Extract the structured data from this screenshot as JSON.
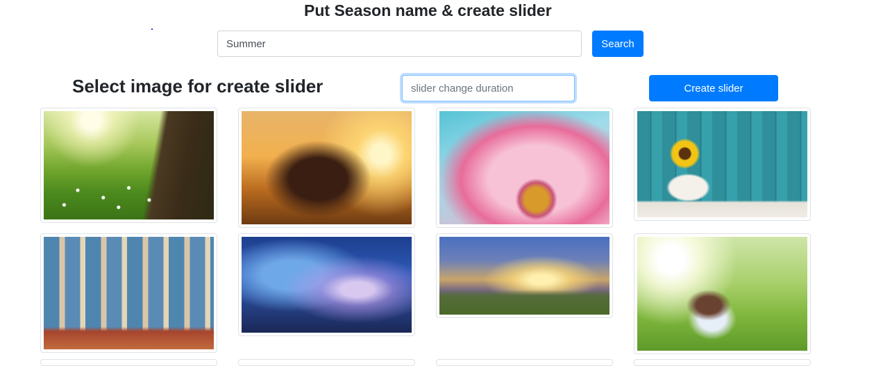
{
  "header": {
    "title": "Put Season name & create slider"
  },
  "search": {
    "value": "Summer",
    "button_label": "Search"
  },
  "slider": {
    "heading": "Select image for create slider",
    "duration_placeholder": "slider change duration",
    "create_label": "Create slider"
  },
  "gallery": {
    "images": [
      {
        "name": "green-meadow-tree-image"
      },
      {
        "name": "girl-sunset-field-image"
      },
      {
        "name": "pink-daisy-image"
      },
      {
        "name": "sunflower-vase-image"
      },
      {
        "name": "cafe-storefront-image"
      },
      {
        "name": "storm-clouds-lightning-image"
      },
      {
        "name": "sunset-hills-image"
      },
      {
        "name": "woman-hat-meadow-image"
      }
    ]
  }
}
